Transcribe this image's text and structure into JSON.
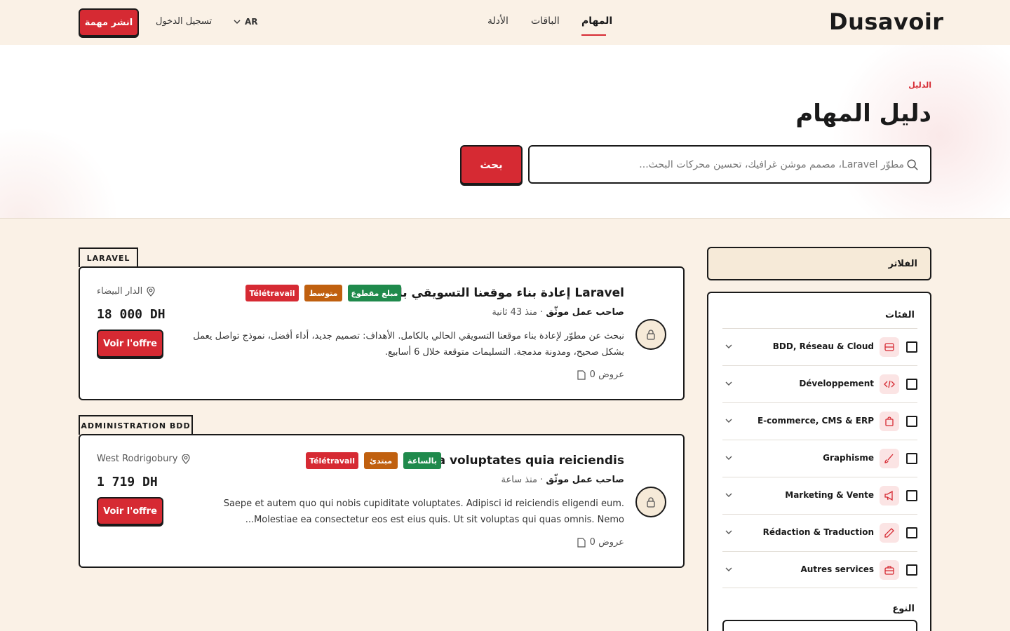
{
  "header": {
    "logo": "Dusavoir",
    "nav": [
      "المهام",
      "الباقات",
      "الأدلة"
    ],
    "lang": "AR",
    "login": "تسجيل الدخول",
    "publish": "انشر مهمة"
  },
  "hero": {
    "breadcrumb": "الدليل",
    "title": "دليل المهام",
    "search_placeholder": "مطوّر Laravel، مصمم موشن غرافيك، تحسين محركات البحث...",
    "search_button": "بحث"
  },
  "jobs": [
    {
      "category": "LARAVEL",
      "title": "إعادة بناء موقعنا التسويقي باستخدام Laravel",
      "tags": [
        "مبلغ مقطوع",
        "متوسط",
        "Télétravail"
      ],
      "client": "صاحب عمل موثّق",
      "posted": "منذ 43 ثانية",
      "description": "نبحث عن مطوّر لإعادة بناء موقعنا التسويقي الحالي بالكامل. الأهداف: تصميم جديد، أداء أفضل، نموذج تواصل يعمل بشكل صحيح، ومدونة مدمجة. التسليمات متوقعة خلال 6 أسابيع.",
      "offers": "0 عروض",
      "location": "الدار البيضاء",
      "price": "18 000 DH",
      "cta": "Voir l'offre"
    },
    {
      "category": "ADMINISTRATION BDD",
      "title": "Quia voluptates quia reiciendis",
      "tags": [
        "بالساعة",
        "مبتدئ",
        "Télétravail"
      ],
      "client": "صاحب عمل موثّق",
      "posted": "منذ ساعة",
      "description": "Saepe et autem quo qui nobis cupiditate voluptates. Adipisci id reiciendis eligendi eum. Molestiae ea consectetur eos est eius quis. Ut sit voluptas qui quas omnis. Nemo...",
      "offers": "0 عروض",
      "location": "West Rodrigobury",
      "price": "1 719 DH",
      "cta": "Voir l'offre"
    }
  ],
  "filters": {
    "header": "الفلاتر",
    "categories_title": "الفئات",
    "categories": [
      {
        "label": "BDD, Réseau & Cloud",
        "icon": "database-icon"
      },
      {
        "label": "Développement",
        "icon": "code-icon"
      },
      {
        "label": "E-commerce, CMS & ERP",
        "icon": "shopping-bag-icon"
      },
      {
        "label": "Graphisme",
        "icon": "brush-icon"
      },
      {
        "label": "Marketing & Vente",
        "icon": "megaphone-icon"
      },
      {
        "label": "Rédaction & Traduction",
        "icon": "pen-icon"
      },
      {
        "label": "Autres services",
        "icon": "briefcase-icon"
      }
    ],
    "type_title": "النوع"
  },
  "colors": {
    "accent": "#d62a33",
    "background": "#faf1e6",
    "tag_green": "#1f8a4c",
    "tag_orange": "#c0600f",
    "tag_red": "#d62a33"
  }
}
